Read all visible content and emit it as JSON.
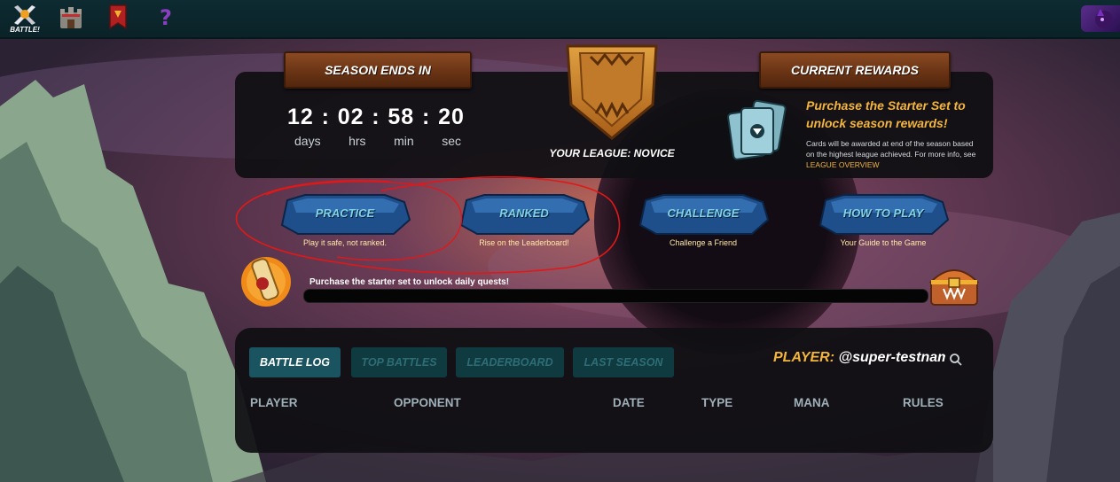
{
  "topnav": {
    "battle_label": "BATTLE!"
  },
  "season": {
    "header": "SEASON ENDS IN",
    "timer": {
      "days": "12",
      "hrs": "02",
      "min": "58",
      "sec": "20"
    },
    "units": {
      "days": "days",
      "hrs": "hrs",
      "min": "min",
      "sec": "sec"
    }
  },
  "league": {
    "label": "YOUR LEAGUE: NOVICE"
  },
  "rewards": {
    "header": "CURRENT REWARDS",
    "title": "Purchase the Starter Set to unlock season rewards!",
    "text": "Cards will be awarded at end of the season based on the highest league achieved. For more info, see",
    "link": "LEAGUE OVERVIEW"
  },
  "modes": [
    {
      "label": "PRACTICE",
      "sub": "Play it safe, not ranked."
    },
    {
      "label": "RANKED",
      "sub": "Rise on the Leaderboard!"
    },
    {
      "label": "CHALLENGE",
      "sub": "Challenge a Friend"
    },
    {
      "label": "HOW TO PLAY",
      "sub": "Your Guide to the Game"
    }
  ],
  "quest": {
    "text": "Purchase the starter set to unlock daily quests!"
  },
  "tabs": [
    "BATTLE LOG",
    "TOP BATTLES",
    "LEADERBOARD",
    "LAST SEASON"
  ],
  "player": {
    "prefix": "PLAYER:",
    "name": "@super-testname"
  },
  "columns": [
    "PLAYER",
    "OPPONENT",
    "DATE",
    "TYPE",
    "MANA",
    "RULES"
  ],
  "colors": {
    "accent_gold": "#f4b53c",
    "tab_active": "#1a5460",
    "mode_text": "#7fd3e6",
    "scribble_red": "#e01818"
  }
}
